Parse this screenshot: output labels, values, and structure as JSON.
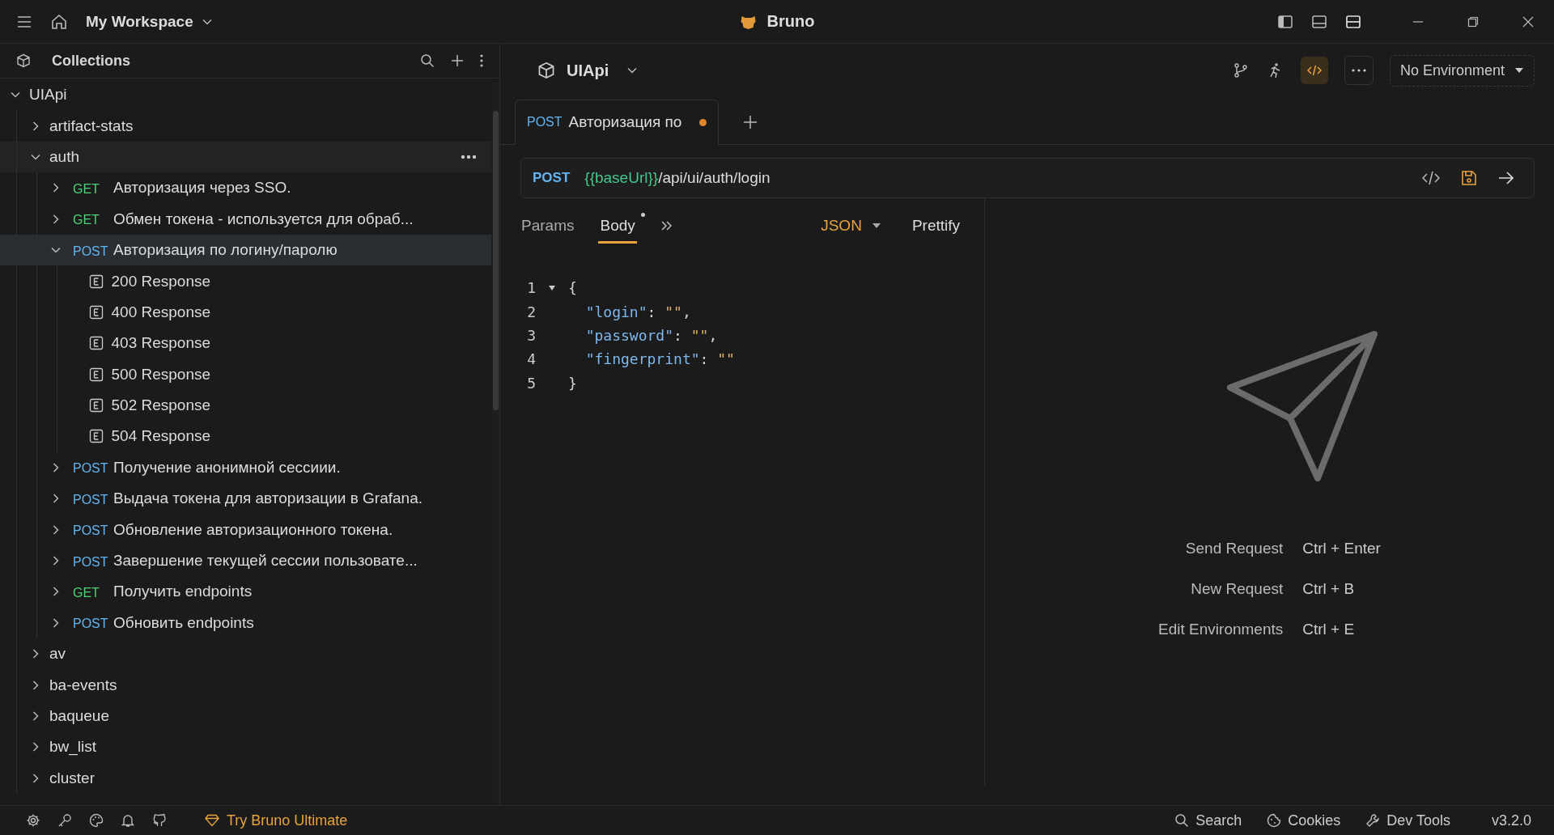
{
  "titlebar": {
    "workspace": "My Workspace",
    "app_title": "Bruno"
  },
  "sidebar": {
    "title": "Collections",
    "tree": [
      {
        "kind": "collection",
        "name": "UIApi",
        "expanded": true,
        "selected": false,
        "hovered": false,
        "children": [
          {
            "kind": "folder",
            "name": "artifact-stats",
            "expanded": false,
            "selected": false,
            "hovered": false
          },
          {
            "kind": "folder",
            "name": "auth",
            "expanded": true,
            "selected": false,
            "hovered": true,
            "children": [
              {
                "kind": "request",
                "method": "GET",
                "name": "Авторизация через SSO.",
                "expanded": false,
                "selected": false,
                "hovered": false
              },
              {
                "kind": "request",
                "method": "GET",
                "name": "Обмен токена - используется для обраб...",
                "expanded": false,
                "selected": false,
                "hovered": false
              },
              {
                "kind": "request",
                "method": "POST",
                "name": "Авторизация по логину/паролю",
                "expanded": true,
                "selected": true,
                "hovered": false,
                "children": [
                  {
                    "kind": "example",
                    "name": "200 Response",
                    "selected": false,
                    "hovered": false
                  },
                  {
                    "kind": "example",
                    "name": "400 Response",
                    "selected": false,
                    "hovered": false
                  },
                  {
                    "kind": "example",
                    "name": "403 Response",
                    "selected": false,
                    "hovered": false
                  },
                  {
                    "kind": "example",
                    "name": "500 Response",
                    "selected": false,
                    "hovered": false
                  },
                  {
                    "kind": "example",
                    "name": "502 Response",
                    "selected": false,
                    "hovered": false
                  },
                  {
                    "kind": "example",
                    "name": "504 Response",
                    "selected": false,
                    "hovered": false
                  }
                ]
              },
              {
                "kind": "request",
                "method": "POST",
                "name": "Получение анонимной сессиии.",
                "expanded": false,
                "selected": false,
                "hovered": false
              },
              {
                "kind": "request",
                "method": "POST",
                "name": "Выдача токена для авторизации в Grafana.",
                "expanded": false,
                "selected": false,
                "hovered": false
              },
              {
                "kind": "request",
                "method": "POST",
                "name": "Обновление авторизационного токена.",
                "expanded": false,
                "selected": false,
                "hovered": false
              },
              {
                "kind": "request",
                "method": "POST",
                "name": "Завершение текущей сессии пользовате...",
                "expanded": false,
                "selected": false,
                "hovered": false
              },
              {
                "kind": "request",
                "method": "GET",
                "name": "Получить endpoints",
                "expanded": false,
                "selected": false,
                "hovered": false
              },
              {
                "kind": "request",
                "method": "POST",
                "name": "Обновить endpoints",
                "expanded": false,
                "selected": false,
                "hovered": false
              }
            ]
          },
          {
            "kind": "folder",
            "name": "av",
            "expanded": false,
            "selected": false,
            "hovered": false
          },
          {
            "kind": "folder",
            "name": "ba-events",
            "expanded": false,
            "selected": false,
            "hovered": false
          },
          {
            "kind": "folder",
            "name": "baqueue",
            "expanded": false,
            "selected": false,
            "hovered": false
          },
          {
            "kind": "folder",
            "name": "bw_list",
            "expanded": false,
            "selected": false,
            "hovered": false
          },
          {
            "kind": "folder",
            "name": "cluster",
            "expanded": false,
            "selected": false,
            "hovered": false
          }
        ]
      }
    ]
  },
  "collection_header": {
    "name": "UIApi",
    "code_view_active": true,
    "environment": "No Environment"
  },
  "request_tabs": [
    {
      "method": "POST",
      "title": "Авторизация по",
      "selected": true,
      "modified": true
    }
  ],
  "url_bar": {
    "method": "POST",
    "variable": "{{baseUrl}}",
    "path": "/api/ui/auth/login"
  },
  "body_tabs": [
    {
      "label": "Params",
      "selected": false,
      "has_content": false
    },
    {
      "label": "Body",
      "selected": true,
      "has_content": true
    }
  ],
  "body_mode": "JSON",
  "prettify": "Prettify",
  "code_lines": [
    {
      "number": "1",
      "foldable": true,
      "tokens": [
        {
          "kind": "punct",
          "text": "{"
        }
      ]
    },
    {
      "number": "2",
      "foldable": false,
      "tokens": [
        {
          "kind": "key",
          "text": "  \"login\""
        },
        {
          "kind": "punct",
          "text": ": "
        },
        {
          "kind": "string",
          "text": "\"\""
        },
        {
          "kind": "punct",
          "text": ","
        }
      ]
    },
    {
      "number": "3",
      "foldable": false,
      "tokens": [
        {
          "kind": "key",
          "text": "  \"password\""
        },
        {
          "kind": "punct",
          "text": ": "
        },
        {
          "kind": "string",
          "text": "\"\""
        },
        {
          "kind": "punct",
          "text": ","
        }
      ]
    },
    {
      "number": "4",
      "foldable": false,
      "tokens": [
        {
          "kind": "key",
          "text": "  \"fingerprint\""
        },
        {
          "kind": "punct",
          "text": ": "
        },
        {
          "kind": "string",
          "text": "\"\""
        }
      ]
    },
    {
      "number": "5",
      "foldable": false,
      "tokens": [
        {
          "kind": "punct",
          "text": "}"
        }
      ]
    }
  ],
  "shortcuts": [
    {
      "label": "Send Request",
      "keys": "Ctrl + Enter"
    },
    {
      "label": "New Request",
      "keys": "Ctrl + B"
    },
    {
      "label": "Edit Environments",
      "keys": "Ctrl + E"
    }
  ],
  "status_bar": {
    "promo": "Try Bruno Ultimate",
    "links": [
      "Search",
      "Cookies",
      "Dev Tools"
    ],
    "version": "v3.2.0"
  }
}
